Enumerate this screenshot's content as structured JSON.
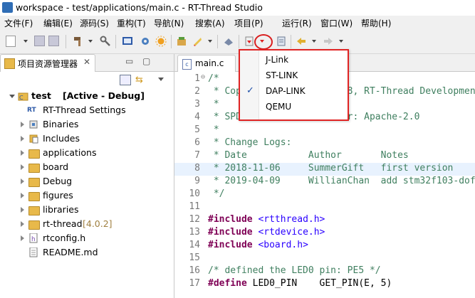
{
  "window": {
    "title": "workspace - test/applications/main.c - RT-Thread Studio"
  },
  "menubar": {
    "items": [
      {
        "label": "文件(F)"
      },
      {
        "label": "编辑(E)"
      },
      {
        "label": "源码(S)"
      },
      {
        "label": "重构(T)"
      },
      {
        "label": "导航(N)"
      },
      {
        "label": "搜索(A)"
      },
      {
        "label": "项目(P)"
      },
      {
        "label": "运行(R)"
      },
      {
        "label": "窗口(W)"
      },
      {
        "label": "帮助(H)"
      }
    ]
  },
  "project_explorer": {
    "tab_label": "项目资源管理器",
    "root": {
      "name": "test",
      "status": "[Active - Debug]"
    },
    "items": [
      {
        "label": "RT-Thread Settings",
        "icon": "rt-settings-icon"
      },
      {
        "label": "Binaries",
        "icon": "binaries-icon"
      },
      {
        "label": "Includes",
        "icon": "includes-icon"
      },
      {
        "label": "applications",
        "icon": "folder-icon"
      },
      {
        "label": "board",
        "icon": "folder-icon"
      },
      {
        "label": "Debug",
        "icon": "folder-icon"
      },
      {
        "label": "figures",
        "icon": "folder-icon"
      },
      {
        "label": "libraries",
        "icon": "folder-icon"
      },
      {
        "label": "rt-thread",
        "version": "[4.0.2]",
        "icon": "folder-icon"
      },
      {
        "label": "rtconfig.h",
        "icon": "header-file-icon"
      },
      {
        "label": "README.md",
        "icon": "text-file-icon"
      }
    ]
  },
  "editor": {
    "tab_label": "main.c",
    "lines": [
      {
        "n": "1",
        "t": "/*"
      },
      {
        "n": "2",
        "t": " * Copyright (c) 2006-2018, RT-Thread Development"
      },
      {
        "n": "3",
        "t": " *"
      },
      {
        "n": "4",
        "t": " * SPDX-License-Identifier: Apache-2.0"
      },
      {
        "n": "5",
        "t": " *"
      },
      {
        "n": "6",
        "t": " * Change Logs:"
      },
      {
        "n": "7",
        "t": " * Date           Author       Notes"
      },
      {
        "n": "8",
        "t": " * 2018-11-06     SummerGift   first version"
      },
      {
        "n": "9",
        "t": " * 2019-04-09     WillianChan  add stm32f103-dof"
      },
      {
        "n": "10",
        "t": " */"
      },
      {
        "n": "11",
        "t": ""
      },
      {
        "n": "12",
        "kw": "#include",
        "rest": " <rtthread.h>"
      },
      {
        "n": "13",
        "kw": "#include",
        "rest": " <rtdevice.h>"
      },
      {
        "n": "14",
        "kw": "#include",
        "rest": " <board.h>"
      },
      {
        "n": "15",
        "t": ""
      },
      {
        "n": "16",
        "t": "/* defined the LED0 pin: PE5 */"
      },
      {
        "n": "17",
        "kw": "#define",
        "rest": " LED0_PIN    GET_PIN(E, 5)"
      }
    ]
  },
  "debugger_menu": {
    "items": [
      {
        "label": "J-Link",
        "checked": false
      },
      {
        "label": "ST-LINK",
        "checked": false
      },
      {
        "label": "DAP-LINK",
        "checked": true
      },
      {
        "label": "QEMU",
        "checked": false
      }
    ],
    "check_glyph": "✓"
  },
  "colors": {
    "highlight_border": "#e02424",
    "comment": "#3f7f5f",
    "keyword": "#7f0055",
    "string": "#2a00ff",
    "line_number": "#787878"
  }
}
